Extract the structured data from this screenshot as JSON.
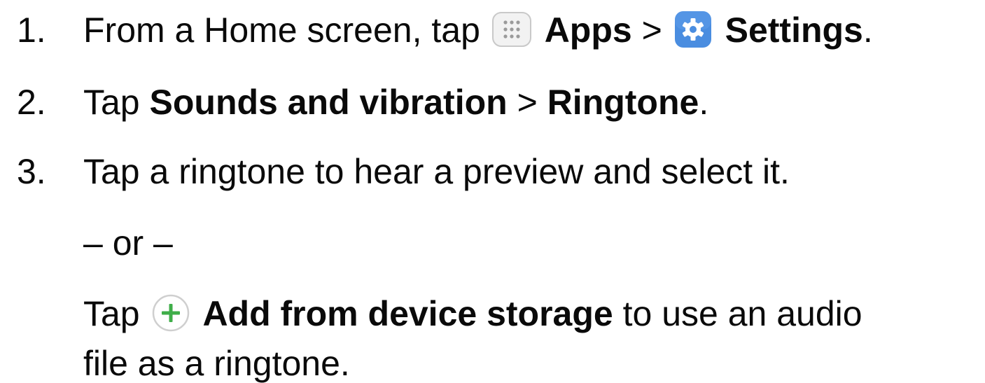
{
  "steps": [
    {
      "number": "1.",
      "parts": {
        "intro": "From a Home screen, tap",
        "apps": "Apps",
        "sep": ">",
        "settings": "Settings",
        "end": "."
      }
    },
    {
      "number": "2.",
      "parts": {
        "intro": "Tap",
        "sounds": "Sounds and vibration",
        "sep": ">",
        "ringtone": "Ringtone",
        "end": "."
      }
    },
    {
      "number": "3.",
      "text": "Tap a ringtone to hear a preview and select it."
    }
  ],
  "alternative": {
    "or_label": "– or –",
    "intro": "Tap",
    "action": "Add from device storage",
    "rest_line1": "to use an audio",
    "rest_line2": "file as a ringtone."
  },
  "icons": {
    "apps": "apps-grid-icon",
    "settings": "settings-gear-icon",
    "add": "add-plus-icon"
  },
  "colors": {
    "text": "#0a0a0a",
    "settings_icon_bg": "#4a8de0",
    "add_icon_plus": "#3fae49",
    "apps_icon_bg": "#f2f2f2"
  }
}
